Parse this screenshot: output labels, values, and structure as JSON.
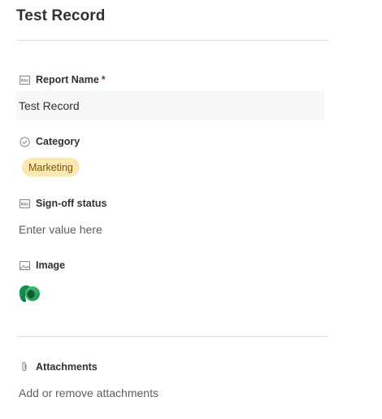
{
  "record": {
    "title": "Test Record"
  },
  "fields": {
    "report_name": {
      "label": "Report Name",
      "required_mark": "*",
      "value": "Test Record",
      "icon": "text-field-icon"
    },
    "category": {
      "label": "Category",
      "value": "Marketing",
      "icon": "choice-check-icon",
      "pill_color": "#fbe8b3"
    },
    "sign_off_status": {
      "label": "Sign-off status",
      "placeholder": "Enter value here",
      "icon": "text-field-icon"
    },
    "image": {
      "label": "Image",
      "icon": "image-icon"
    },
    "attachments": {
      "label": "Attachments",
      "placeholder": "Add or remove attachments",
      "icon": "paperclip-icon"
    }
  },
  "colors": {
    "required": "#a4262c",
    "field_bg": "#f8f7f6",
    "divider": "#e1dfdd"
  }
}
